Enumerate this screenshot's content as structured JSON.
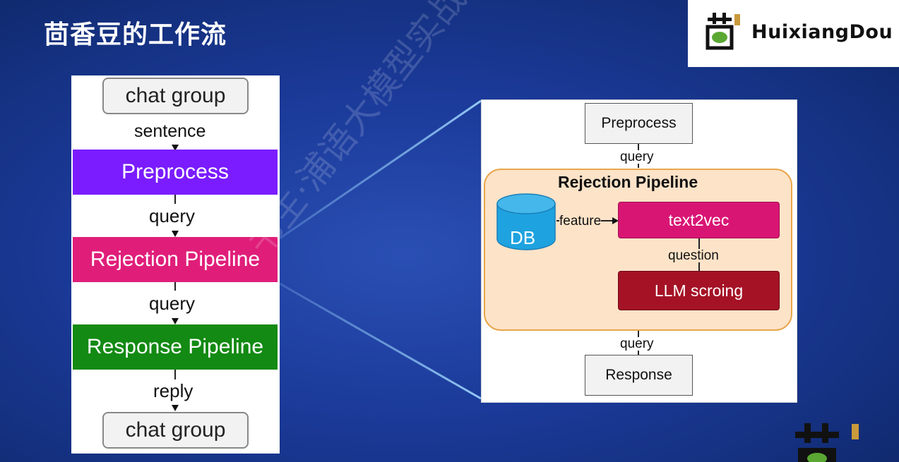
{
  "slide": {
    "title": "茴香豆的工作流"
  },
  "logo": {
    "text": "HuixiangDou",
    "icon": "fennel-bean-logo-icon"
  },
  "watermark": {
    "text": "书生·浦语大模型实战营"
  },
  "left_flow": {
    "nodes": {
      "top": "chat group",
      "preprocess": "Preprocess",
      "rejection": "Rejection Pipeline",
      "response": "Response Pipeline",
      "bottom": "chat group"
    },
    "edges": {
      "sentence": "sentence",
      "query1": "query",
      "query2": "query",
      "reply": "reply"
    }
  },
  "right_flow": {
    "preprocess": "Preprocess",
    "query_in": "query",
    "group_title": "Rejection Pipeline",
    "db": "DB",
    "feature": "feature",
    "text2vec": "text2vec",
    "question": "question",
    "llm": "LLM scroing",
    "query_out": "query",
    "response": "Response"
  },
  "colors": {
    "background": "#1b3a99",
    "preprocess": "#7a1cff",
    "rejection": "#e01e7a",
    "response": "#138a13",
    "text2vec": "#d91574",
    "llm": "#a51226",
    "db": "#1ea3e0",
    "rejection_group": "#fde3c8"
  }
}
